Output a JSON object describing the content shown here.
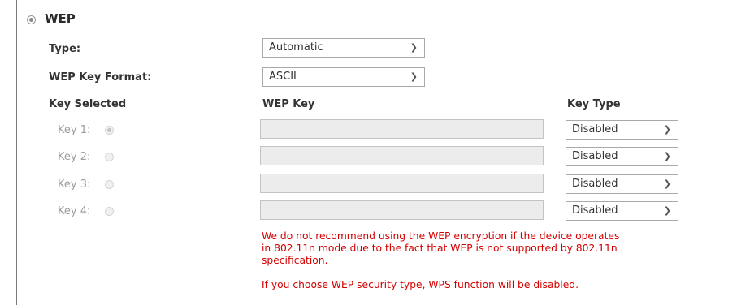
{
  "section": {
    "title": "WEP"
  },
  "type_field": {
    "label": "Type:",
    "value": "Automatic"
  },
  "format_field": {
    "label": "WEP Key Format:",
    "value": "ASCII"
  },
  "columns": {
    "key_selected": "Key Selected",
    "wep_key": "WEP Key",
    "key_type": "Key Type"
  },
  "keys": [
    {
      "label": "Key 1:",
      "selected": true,
      "value": "",
      "type": "Disabled"
    },
    {
      "label": "Key 2:",
      "selected": false,
      "value": "",
      "type": "Disabled"
    },
    {
      "label": "Key 3:",
      "selected": false,
      "value": "",
      "type": "Disabled"
    },
    {
      "label": "Key 4:",
      "selected": false,
      "value": "",
      "type": "Disabled"
    }
  ],
  "warnings": {
    "line1": "We do not recommend using the WEP encryption if the device operates",
    "line2": "in 802.11n mode due to the fact that WEP is not supported by 802.11n",
    "line3": "specification.",
    "line4": "If you choose WEP security type, WPS function will be disabled."
  },
  "icons": {
    "chevron": "chevron-down-icon"
  },
  "colors": {
    "warning": "#d40000",
    "disabled_text": "#9c9c9c",
    "key_field_bg": "#ececec"
  }
}
